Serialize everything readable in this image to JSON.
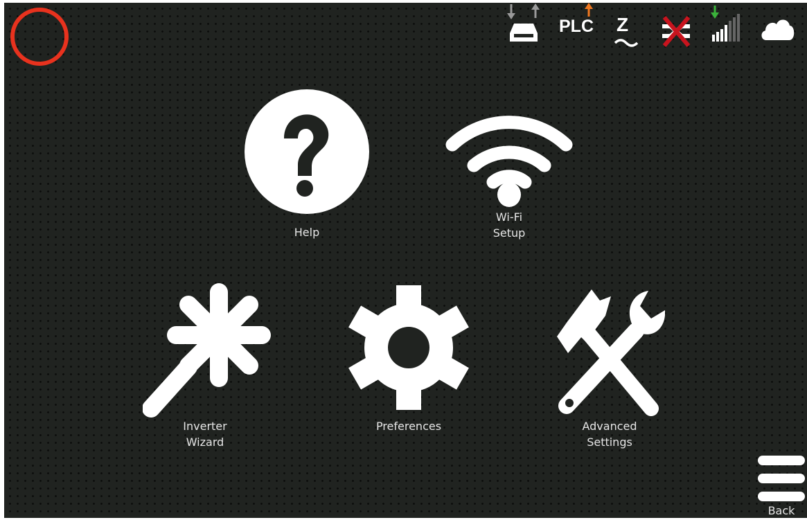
{
  "status_bar": {
    "plc_label": "PLC",
    "zigbee_label": "Z",
    "icons": [
      "home-indicator-icon",
      "storage-icon",
      "plc-icon",
      "zigbee-icon",
      "disconnected-icon",
      "signal-strength-icon",
      "cloud-icon"
    ],
    "colors": {
      "home_ring": "#e8321e",
      "plc_arrow": "#f07820",
      "signal_arrow": "#3ab23a",
      "disconnect_x": "#c8141e",
      "storage_arrows": "#9a9a9a"
    }
  },
  "menu": {
    "help": {
      "label": "Help",
      "icon": "question-icon"
    },
    "wifi": {
      "label": "Wi-Fi\nSetup",
      "icon": "wifi-icon"
    },
    "inverter": {
      "label": "Inverter\nWizard",
      "icon": "magic-wand-icon"
    },
    "preferences": {
      "label": "Preferences",
      "icon": "gear-icon"
    },
    "advanced": {
      "label": "Advanced\nSettings",
      "icon": "tools-icon"
    }
  },
  "footer": {
    "back_label": "Back",
    "back_icon": "hamburger-icon"
  }
}
